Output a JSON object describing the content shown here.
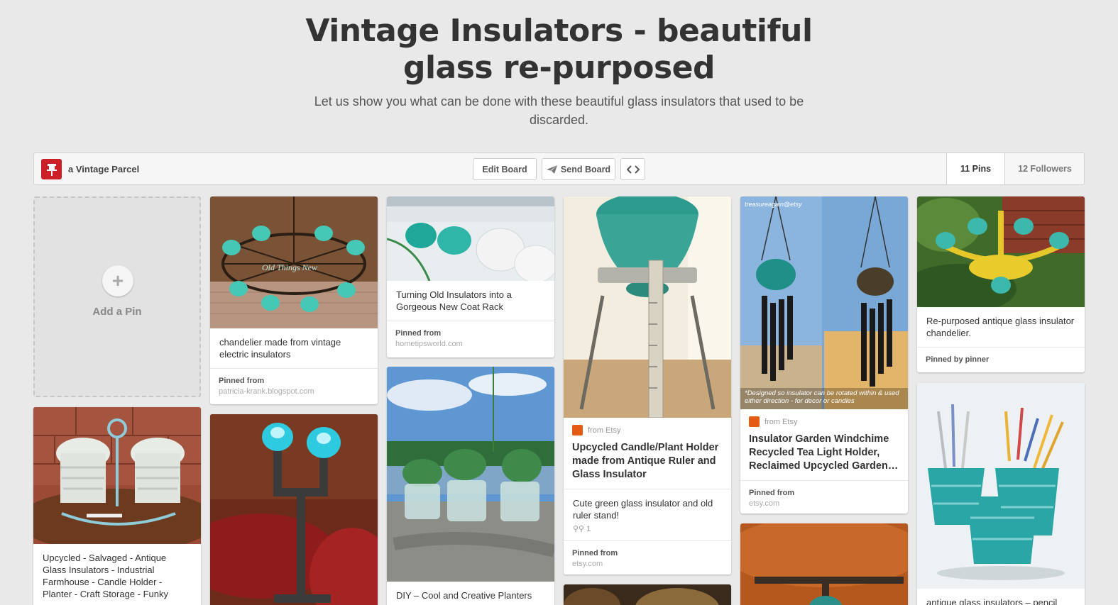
{
  "board": {
    "title": "Vintage Insulators - beautiful glass re-purposed",
    "description": "Let us show you what can be done with these beautiful glass insulators that used to be discarded."
  },
  "toolbar": {
    "owner": "a Vintage Parcel",
    "edit_label": "Edit Board",
    "send_label": "Send Board",
    "pins_label": "11 Pins",
    "followers_label": "12 Followers"
  },
  "add_pin": {
    "label": "Add a Pin"
  },
  "pins": [
    {
      "description": "chandelier made from vintage electric insulators",
      "source_label": "Pinned from",
      "source": "patricia-krank.blogspot.com",
      "watermark": "Old Things New"
    },
    {
      "description": "Turning Old Insulators into a Gorgeous New Coat Rack",
      "source_label": "Pinned from",
      "source": "hometipsworld.com"
    },
    {
      "from": "from Etsy",
      "title": "Upcycled Candle/Plant Holder made from Antique Ruler and Glass Insulator",
      "description": "Cute green glass insulator and old ruler stand!",
      "repins": "1",
      "source_label": "Pinned from",
      "source": "etsy.com"
    },
    {
      "watermark_top": "treasureagain@etsy",
      "caption": "*Designed so insulator can be rotated within & used either direction - for decor or candles",
      "from": "from Etsy",
      "title": "Insulator Garden Windchime Recycled Tea Light Holder, Reclaimed Upcycled Garden…",
      "source_label": "Pinned from",
      "source": "etsy.com"
    },
    {
      "description": "Re-purposed antique glass insulator chandelier.",
      "source_label": "Pinned by pinner"
    },
    {
      "description": "Upcycled - Salvaged - Antique Glass Insulators - Industrial Farmhouse - Candle Holder - Planter - Craft Storage - Funky"
    },
    {
      "description": "DIY – Cool and Creative Planters"
    },
    {
      "description": "antique glass insulators – pencil"
    }
  ],
  "colors": {
    "brand": "#cb2027",
    "etsy": "#e55b13",
    "teal_glass": "#2fa59c"
  }
}
